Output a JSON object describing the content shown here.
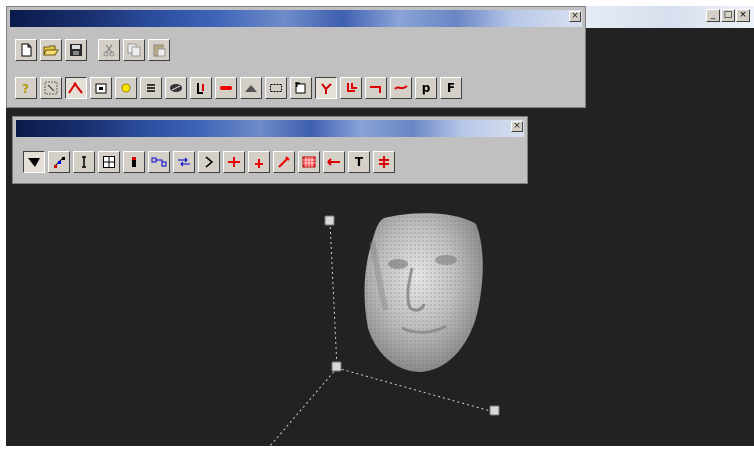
{
  "main_window": {
    "title": "",
    "controls": {
      "minimize": "_",
      "maximize": "□",
      "close": "×"
    }
  },
  "palettes": {
    "file_toolbar": {
      "close_glyph": "×",
      "file_buttons": [
        "new-file-icon",
        "open-folder-icon",
        "save-disk-icon"
      ],
      "edit_buttons": [
        "cut-scissors-icon",
        "copy-icon",
        "paste-icon"
      ],
      "tool_buttons": [
        "help-question-icon",
        "select-cursor-icon",
        "polyline-icon",
        "box-icon",
        "light-bulb-icon",
        "list-icon",
        "sphere-icon",
        "axis-icon",
        "minus-red-icon",
        "mountain-icon",
        "rect-select-icon",
        "crop-icon",
        "branch-red-icon",
        "split-red-icon",
        "hook-red-icon",
        "tilde-red-icon",
        "letter-p-icon",
        "letter-f-icon"
      ],
      "text_glyphs": {
        "letter_p": "p",
        "letter_f": "F"
      }
    },
    "view_toolbar": {
      "close_glyph": "×",
      "buttons": [
        "shade-icon",
        "nodes-icon",
        "split-icon",
        "grid-box-icon",
        "bar-icon",
        "link-icon",
        "arrows-icon",
        "chevron-right-icon",
        "cross-red-icon",
        "plus-red-icon",
        "dropper-red-icon",
        "mesh-red-icon",
        "arrow-left-red-icon",
        "text-tool-icon",
        "align-red-icon"
      ],
      "text_glyphs": {
        "text_tool": "T"
      }
    }
  },
  "viewport": {
    "background": "#222222",
    "model": "3D face scan point cloud",
    "axis_color": "#cccccc",
    "mesh_color": "#b8b8b8"
  }
}
